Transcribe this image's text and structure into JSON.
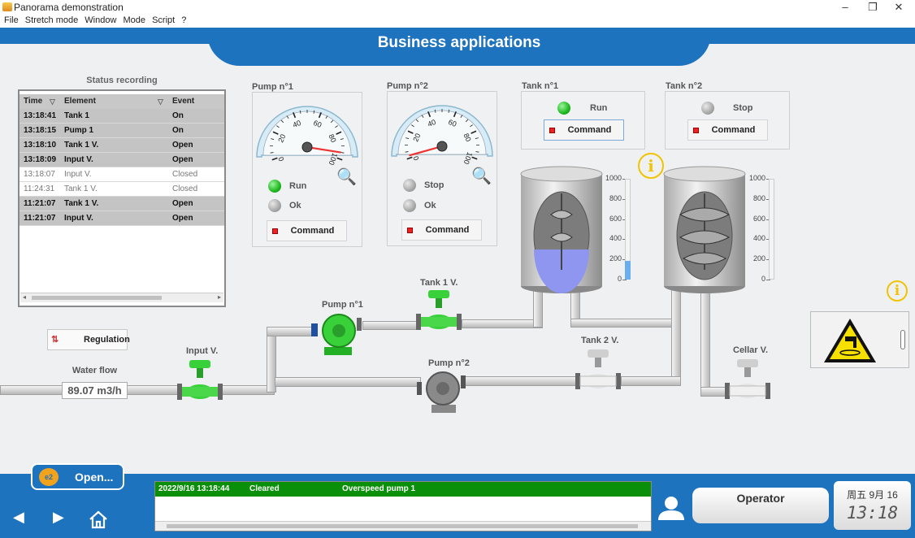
{
  "window": {
    "title": "Panorama demonstration",
    "controls": [
      "–",
      "❐",
      "✕"
    ]
  },
  "menu": [
    "File",
    "Stretch mode",
    "Window",
    "Mode",
    "Script",
    "?"
  ],
  "header": {
    "title": "Business applications",
    "accent": "#1e73be"
  },
  "status_recording": {
    "title": "Status recording",
    "columns": [
      "Time",
      "Element",
      "Event"
    ],
    "rows": [
      {
        "time": "13:18:41",
        "element": "Tank 1",
        "event": "On",
        "style": "dk"
      },
      {
        "time": "13:18:15",
        "element": "Pump 1",
        "event": "On",
        "style": "dk"
      },
      {
        "time": "13:18:10",
        "element": "Tank 1 V.",
        "event": "Open",
        "style": "dk"
      },
      {
        "time": "13:18:09",
        "element": "Input V.",
        "event": "Open",
        "style": "dk"
      },
      {
        "time": "13:18:07",
        "element": "Input V.",
        "event": "Closed",
        "style": "lt"
      },
      {
        "time": "11:24:31",
        "element": "Tank 1 V.",
        "event": "Closed",
        "style": "lt"
      },
      {
        "time": "11:21:07",
        "element": "Tank 1 V.",
        "event": "Open",
        "style": "dk"
      },
      {
        "time": "11:21:07",
        "element": "Input V.",
        "event": "Open",
        "style": "dk"
      }
    ]
  },
  "pump1": {
    "title": "Pump n°1",
    "state": "Run",
    "ok": "Ok",
    "command": "Command",
    "gauge_value": 95,
    "gauge_ticks": [
      "0",
      "20",
      "40",
      "60",
      "80",
      "100"
    ]
  },
  "pump2": {
    "title": "Pump n°2",
    "state": "Stop",
    "ok": "Ok",
    "command": "Command",
    "gauge_value": 2,
    "gauge_ticks": [
      "0",
      "20",
      "40",
      "60",
      "80",
      "100"
    ]
  },
  "tank1": {
    "title": "Tank n°1",
    "state": "Run",
    "command": "Command",
    "level": 185,
    "scale": [
      "1000",
      "800",
      "600",
      "400",
      "200",
      "0"
    ]
  },
  "tank2": {
    "title": "Tank n°2",
    "state": "Stop",
    "command": "Command",
    "level": 0,
    "scale": [
      "1000",
      "800",
      "600",
      "400",
      "200",
      "0"
    ]
  },
  "labels": {
    "tank1_valve": "Tank 1 V.",
    "pump1": "Pump n°1",
    "pump2": "Pump n°2",
    "input_valve": "Input V.",
    "tank2_valve": "Tank 2 V.",
    "cellar_valve": "Cellar V."
  },
  "regulation": {
    "label": "Regulation"
  },
  "water_flow": {
    "label": "Water flow",
    "value": "89.07 m3/h"
  },
  "footer": {
    "open_label": "Open...",
    "alarm": {
      "datetime": "2022/9/16 13:18:44",
      "status": "Cleared",
      "message": "Overspeed pump 1"
    },
    "operator": "Operator",
    "clock_date": "周五 9月 16",
    "clock_time": "13:18"
  }
}
